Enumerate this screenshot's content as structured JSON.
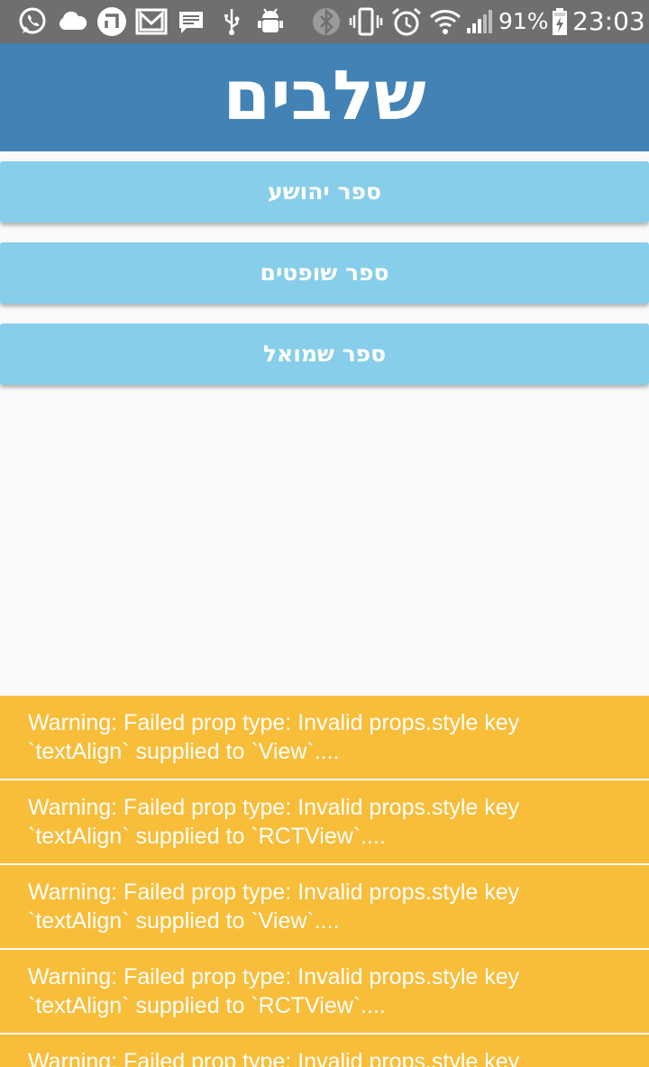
{
  "status_bar": {
    "battery_percent": "91%",
    "time": "23:03",
    "icons": [
      "whatsapp-icon",
      "cloud-icon",
      "hebrew-he-icon",
      "gmail-icon",
      "message-icon",
      "usb-icon",
      "android-debug-icon",
      "bluetooth-icon",
      "vibrate-icon",
      "alarm-icon",
      "wifi-icon",
      "signal-icon",
      "battery-charging-icon"
    ]
  },
  "header": {
    "title": "שלבים"
  },
  "books": [
    {
      "label": "ספר יהושע"
    },
    {
      "label": "ספר שופטים"
    },
    {
      "label": "ספר שמואל"
    }
  ],
  "warnings": [
    {
      "line1": "Warning: Failed prop type: Invalid props.style key",
      "line2": "`textAlign` supplied to `View`...."
    },
    {
      "line1": "Warning: Failed prop type: Invalid props.style key",
      "line2": "`textAlign` supplied to `RCTView`...."
    },
    {
      "line1": "Warning: Failed prop type: Invalid props.style key",
      "line2": "`textAlign` supplied to `View`...."
    },
    {
      "line1": "Warning: Failed prop type: Invalid props.style key",
      "line2": "`textAlign` supplied to `RCTView`...."
    },
    {
      "line1": "Warning: Failed prop type: Invalid props.style key",
      "line2": ""
    }
  ],
  "colors": {
    "status_bar": "#6f6f6f",
    "header": "#4382b4",
    "book_button": "#87ceea",
    "warning": "#f8bd39",
    "background": "#fafafa"
  }
}
